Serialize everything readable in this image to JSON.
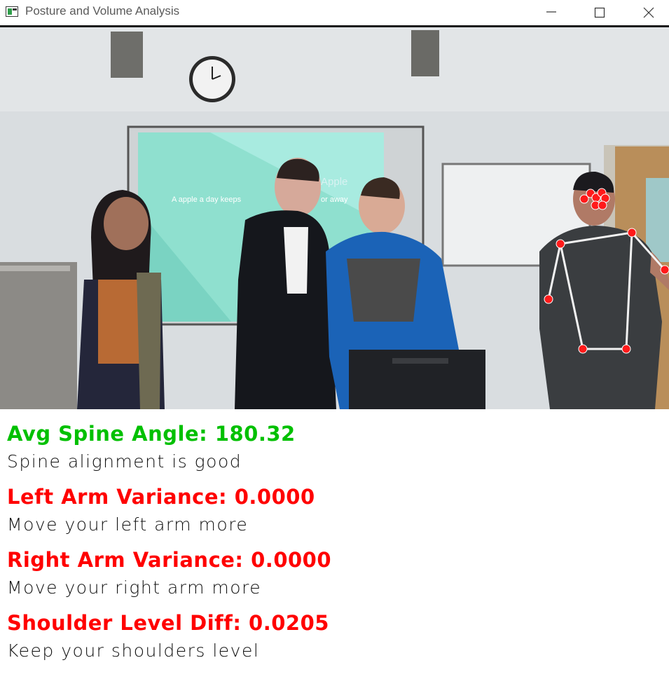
{
  "window": {
    "title": "Posture and Volume Analysis",
    "buttons": {
      "minimize": "minimize-icon",
      "maximize": "maximize-icon",
      "close": "close-icon"
    }
  },
  "video": {
    "slide_heading": "Apple",
    "slide_text": "A apple a day keeps",
    "slide_text_end": "or away"
  },
  "colors": {
    "good": "#00c000",
    "bad": "#ff0000",
    "skeleton_joint": "#ff0000",
    "skeleton_bone": "#ffffff"
  },
  "metrics": [
    {
      "label": "Avg Spine Angle: 180.32",
      "status": "good",
      "message": "Spine alignment is good"
    },
    {
      "label": "Left Arm Variance: 0.0000",
      "status": "bad",
      "message": "Move your left arm more"
    },
    {
      "label": "Right Arm Variance: 0.0000",
      "status": "bad",
      "message": "Move your right arm more"
    },
    {
      "label": "Shoulder Level Diff: 0.0205",
      "status": "bad",
      "message": "Keep your shoulders level"
    }
  ]
}
